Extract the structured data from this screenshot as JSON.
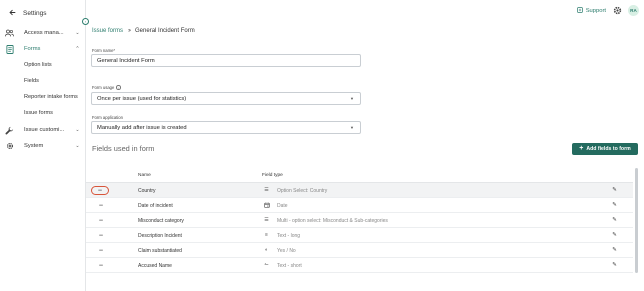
{
  "sidebar": {
    "back_label": "Settings",
    "items": [
      {
        "label": "Access mana...",
        "icon": "users-icon"
      },
      {
        "label": "Forms",
        "icon": "forms-icon"
      },
      {
        "label": "Issue customi...",
        "icon": "wrench-icon"
      },
      {
        "label": "System",
        "icon": "gear-icon"
      }
    ],
    "forms_sub": [
      "Option lists",
      "Fields",
      "Reporter intake forms",
      "Issue forms"
    ]
  },
  "topbar": {
    "support_label": "Support",
    "avatar_initials": "RA"
  },
  "breadcrumb": {
    "parent": "Issue forms",
    "current": "General Incident Form"
  },
  "form": {
    "name_label": "Form name*",
    "name_value": "General Incident Form",
    "usage_label": "Form usage",
    "usage_value": "Once per issue (used for statistics)",
    "application_label": "Form application",
    "application_value": "Manually add after issue is created"
  },
  "fields_section": {
    "title": "Fields used in form",
    "add_button": "Add fields to form",
    "columns": {
      "name": "Name",
      "type": "Field type"
    },
    "rows": [
      {
        "name": "Country",
        "type": "Option Select: Country",
        "type_icon": "list-icon"
      },
      {
        "name": "Date of incident",
        "type": "Date",
        "type_icon": "calendar-icon"
      },
      {
        "name": "Misconduct category",
        "type": "Multi - option select: Misconduct & Sub-categories",
        "type_icon": "list-icon"
      },
      {
        "name": "Description Incident",
        "type": "Text - long",
        "type_icon": "text-long-icon"
      },
      {
        "name": "Claim substantiated",
        "type": "Yes / No",
        "type_icon": "half-circle-icon"
      },
      {
        "name": "Accused Name",
        "type": "Text - short",
        "type_icon": "text-short-icon"
      }
    ]
  },
  "colors": {
    "accent": "#2d7d6e",
    "button": "#246b5f",
    "highlight_ring": "#d8553a"
  }
}
